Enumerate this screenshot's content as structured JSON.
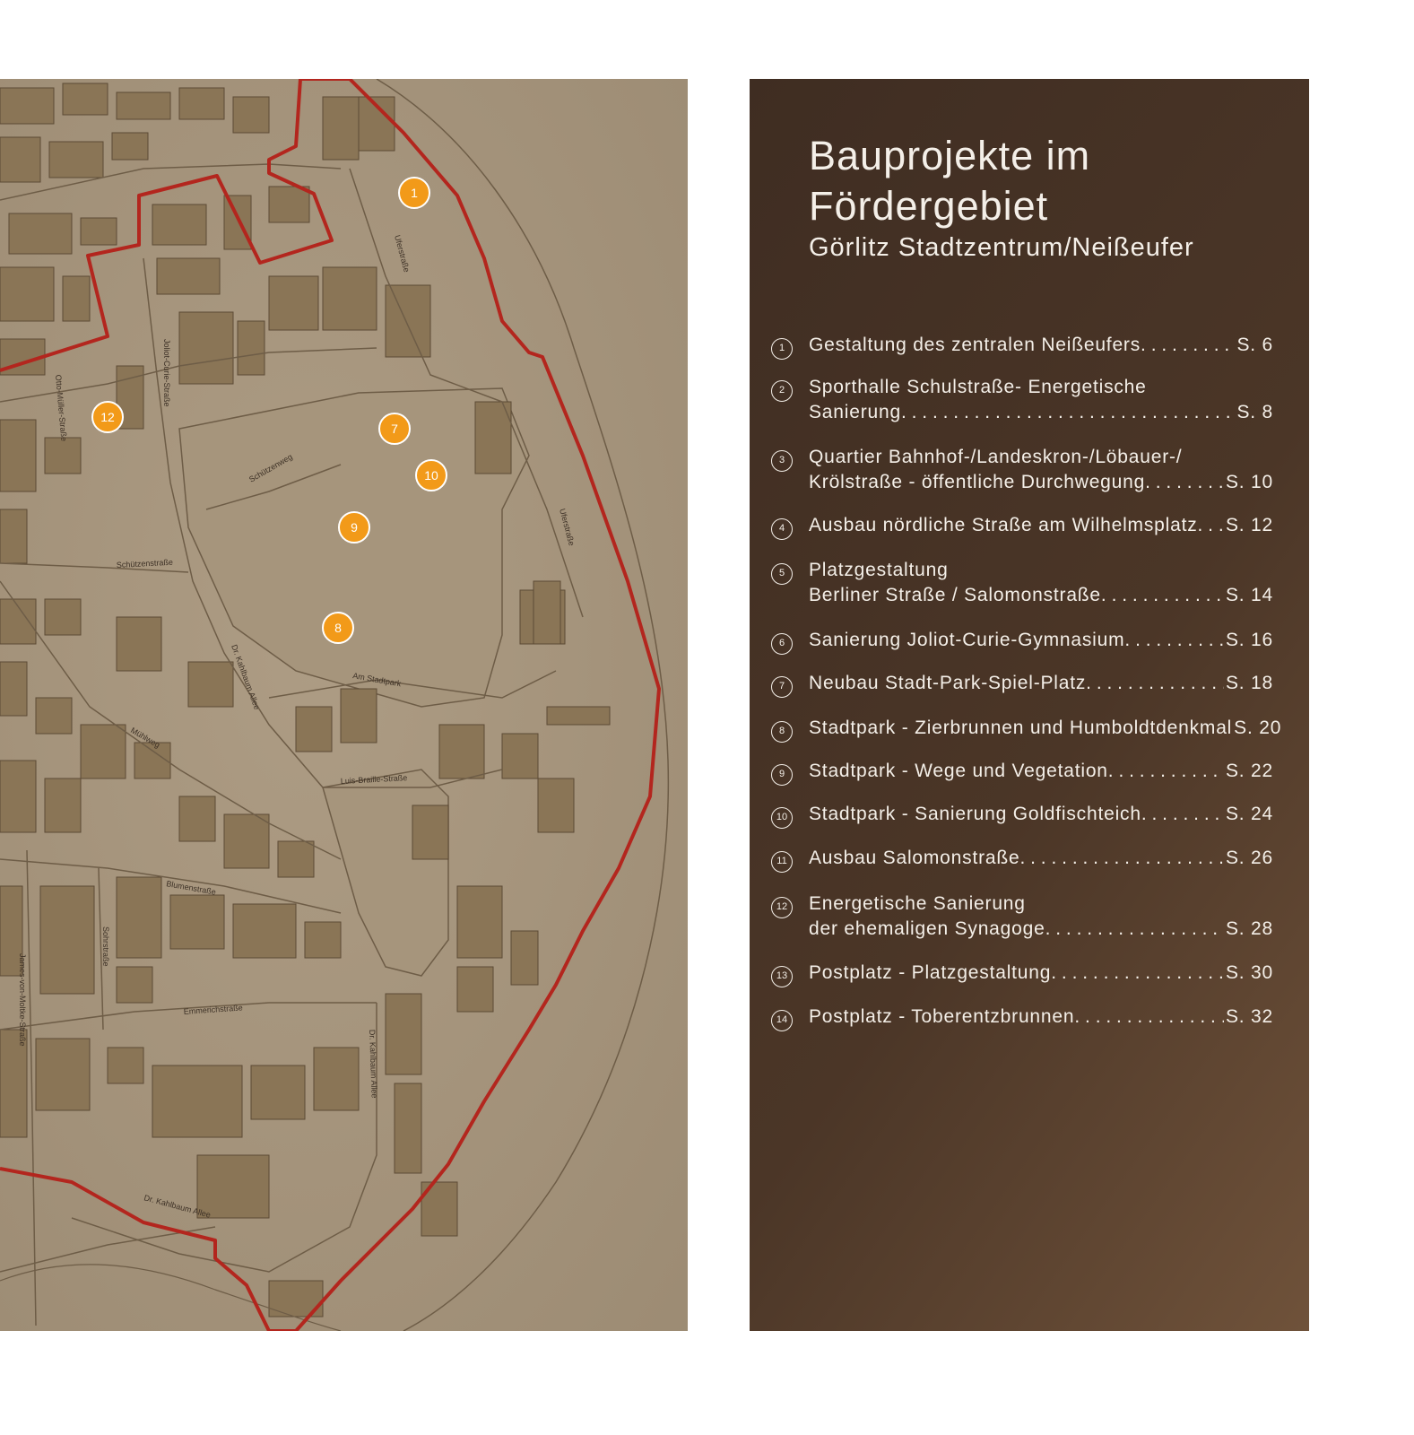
{
  "map": {
    "streets": [
      {
        "id": "s1",
        "name": "Uferstraße"
      },
      {
        "id": "s2",
        "name": "Joliot-Curie-Straße"
      },
      {
        "id": "s3",
        "name": "Otto-Müller-Straße"
      },
      {
        "id": "s4",
        "name": "Schützenweg"
      },
      {
        "id": "s5",
        "name": "Uferstraße"
      },
      {
        "id": "s6",
        "name": "Schützenstraße"
      },
      {
        "id": "s7",
        "name": "Dr. Kahlbaum Allee"
      },
      {
        "id": "s8",
        "name": "Am Stadtpark"
      },
      {
        "id": "s9",
        "name": "Mühlweg"
      },
      {
        "id": "s10",
        "name": "Luis-Braille-Straße"
      },
      {
        "id": "s11",
        "name": "Blumenstraße"
      },
      {
        "id": "s12",
        "name": "Sohrstraße"
      },
      {
        "id": "s13",
        "name": "James-von-Moltke-Straße"
      },
      {
        "id": "s14",
        "name": "Emmerichstraße"
      },
      {
        "id": "s15",
        "name": "Dr. Kahlbaum Allee"
      },
      {
        "id": "s16",
        "name": "Dr. Kahlbaum Allee"
      }
    ],
    "markers": [
      {
        "id": "m1",
        "label": "1"
      },
      {
        "id": "m12",
        "label": "12"
      },
      {
        "id": "m7",
        "label": "7"
      },
      {
        "id": "m10",
        "label": "10"
      },
      {
        "id": "m9",
        "label": "9"
      },
      {
        "id": "m8",
        "label": "8"
      }
    ],
    "colors": {
      "paper": "#a8977f",
      "block": "#8a7556",
      "boundary": "#b3261e",
      "marker": "#f29a19"
    }
  },
  "panel": {
    "title_line1": "Bauprojekte im",
    "title_line2": "Fördergebiet",
    "subtitle": "Görlitz Stadtzentrum/Neißeufer",
    "toc": [
      {
        "num": "1",
        "lines": [
          "Gestaltung des zentralen Neißeufers"
        ],
        "page": "S. 6"
      },
      {
        "num": "2",
        "lines": [
          "Sporthalle Schulstraße- Energetische",
          "Sanierung"
        ],
        "page": "S. 8"
      },
      {
        "num": "3",
        "lines": [
          "Quartier Bahnhof-/Landeskron-/Löbauer-/",
          "Krölstraße - öffentliche Durchwegung"
        ],
        "page": "S. 10"
      },
      {
        "num": "4",
        "lines": [
          "Ausbau nördliche Straße am Wilhelmsplatz"
        ],
        "page": "S. 12"
      },
      {
        "num": "5",
        "lines": [
          "Platzgestaltung",
          "Berliner Straße / Salomonstraße"
        ],
        "page": "S. 14"
      },
      {
        "num": "6",
        "lines": [
          "Sanierung Joliot-Curie-Gymnasium"
        ],
        "page": "S. 16"
      },
      {
        "num": "7",
        "lines": [
          "Neubau Stadt-Park-Spiel-Platz"
        ],
        "page": "S. 18"
      },
      {
        "num": "8",
        "lines": [
          "Stadtpark - Zierbrunnen und Humboldtdenkmal"
        ],
        "page": "S. 20"
      },
      {
        "num": "9",
        "lines": [
          "Stadtpark - Wege und Vegetation"
        ],
        "page": "S. 22"
      },
      {
        "num": "10",
        "lines": [
          "Stadtpark - Sanierung Goldfischteich"
        ],
        "page": "S. 24"
      },
      {
        "num": "11",
        "lines": [
          "Ausbau Salomonstraße"
        ],
        "page": "S. 26"
      },
      {
        "num": "12",
        "lines": [
          "Energetische Sanierung",
          "der ehemaligen Synagoge"
        ],
        "page": "S. 28"
      },
      {
        "num": "13",
        "lines": [
          "Postplatz - Platzgestaltung"
        ],
        "page": "S. 30"
      },
      {
        "num": "14",
        "lines": [
          "Postplatz - Toberentzbrunnen"
        ],
        "page": "S. 32"
      }
    ]
  }
}
